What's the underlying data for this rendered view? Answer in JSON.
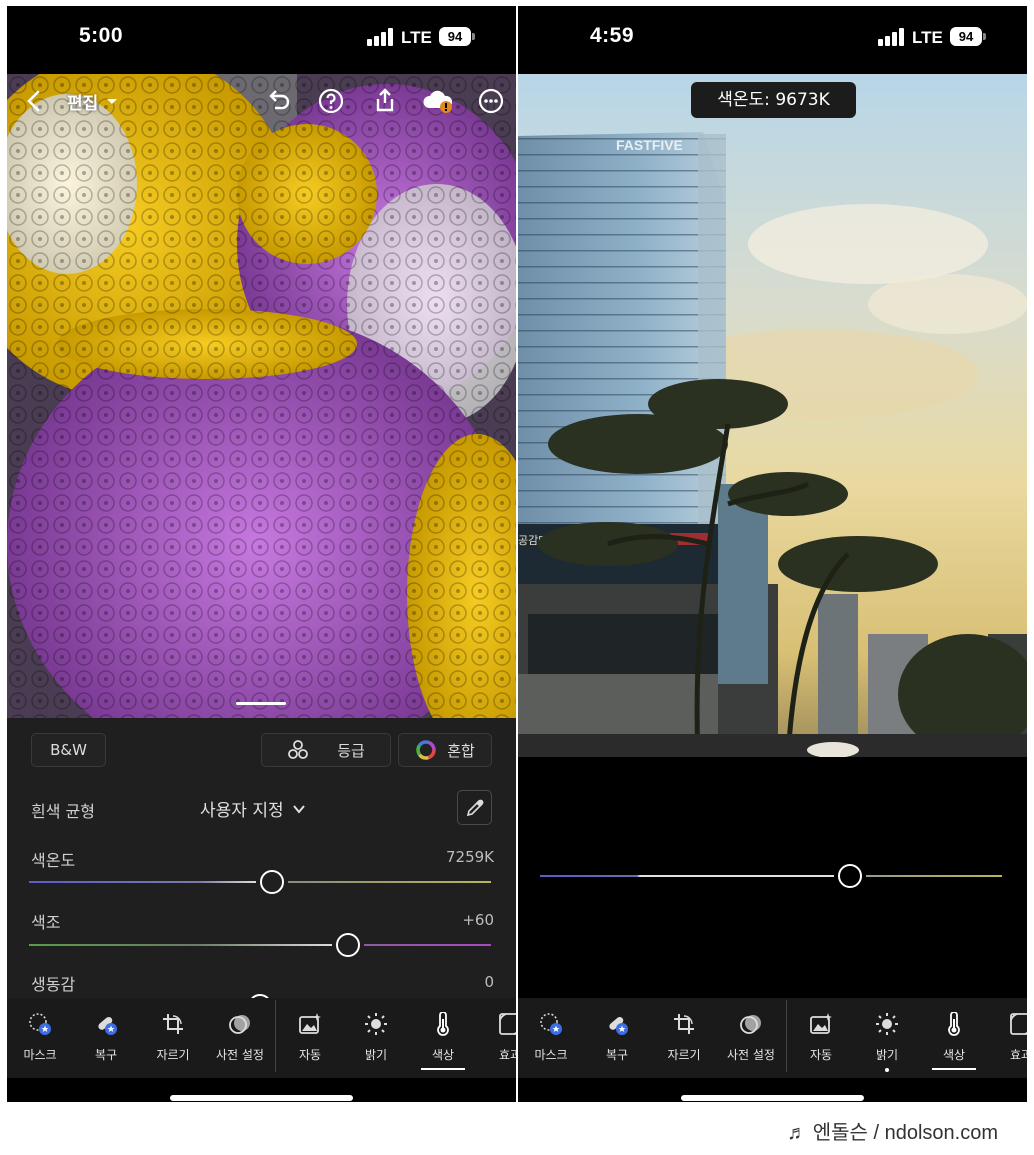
{
  "left": {
    "status": {
      "time": "5:00",
      "network": "LTE",
      "battery": "94"
    },
    "topbar": {
      "edit_title": "편집"
    },
    "chips": {
      "bw": "B&W",
      "grade": "등급",
      "mix": "혼합"
    },
    "white_balance": {
      "label": "흰색 균형",
      "value": "사용자 지정"
    },
    "temperature": {
      "label": "색온도",
      "value": "7259K",
      "position": 0.525
    },
    "tint": {
      "label": "색조",
      "value": "+60",
      "position": 0.69
    },
    "vibrance": {
      "label": "생동감",
      "value": "0",
      "position": 0.5
    },
    "tools": [
      "마스크",
      "복구",
      "자르기",
      "사전 설정",
      "자동",
      "밝기",
      "색상",
      "효과"
    ],
    "active_tool": "색상"
  },
  "right": {
    "status": {
      "time": "4:59",
      "network": "LTE",
      "battery": "94"
    },
    "temperature_pill": "색온도: 9673K",
    "temperature_position": 0.67,
    "photo_sign_building": "FASTFIVE",
    "photo_sign_store": "공감마취통증의학과의원",
    "tools": [
      "마스크",
      "복구",
      "자르기",
      "사전 설정",
      "자동",
      "밝기",
      "색상",
      "효과"
    ],
    "active_tool": "색상"
  },
  "watermark": "♬ 엔돌슨 / ndolson.com",
  "colors": {
    "panel_bg": "#1f1f1f",
    "toolbar_bg": "#1a1a1a",
    "temp_blue": "#5a5ccc",
    "temp_yellow": "#b9b55a",
    "tint_green": "#5a9c48",
    "tint_magenta": "#a44cc0"
  }
}
